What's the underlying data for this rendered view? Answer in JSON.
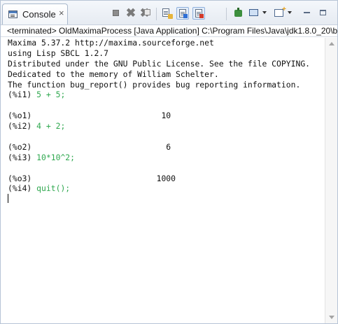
{
  "view": {
    "tab_label": "Console",
    "tab_close_glyph": "×",
    "tab_icon": "console-icon"
  },
  "toolbar": {
    "buttons": [
      {
        "name": "terminate",
        "icon": "terminate-icon"
      },
      {
        "name": "remove-launch",
        "icon": "remove-icon",
        "glyph": "✖"
      },
      {
        "name": "remove-all-terminated",
        "icon": "remove-all-icon",
        "glyph": "✖"
      },
      {
        "name": "scroll-lock",
        "icon": "scroll-lock-icon"
      },
      {
        "name": "show-console-on-stdout",
        "icon": "stdout-icon"
      },
      {
        "name": "show-console-on-stderr",
        "icon": "stderr-icon"
      },
      {
        "name": "pin-console",
        "icon": "pin-icon"
      },
      {
        "name": "display-selected-console",
        "icon": "display-console-icon"
      },
      {
        "name": "open-console",
        "icon": "open-console-icon"
      },
      {
        "name": "minimize",
        "icon": "minimize-icon"
      },
      {
        "name": "maximize",
        "icon": "maximize-icon"
      }
    ]
  },
  "process": {
    "label": "<terminated> OldMaximaProcess [Java Application] C:\\Program Files\\Java\\jdk1.8.0_20\\b"
  },
  "console": {
    "lines": [
      {
        "out": "Maxima 5.37.2 http://maxima.sourceforge.net",
        "in": ""
      },
      {
        "out": "using Lisp SBCL 1.2.7",
        "in": ""
      },
      {
        "out": "Distributed under the GNU Public License. See the file COPYING.",
        "in": ""
      },
      {
        "out": "Dedicated to the memory of William Schelter.",
        "in": ""
      },
      {
        "out": "The function bug_report() provides bug reporting information.",
        "in": ""
      },
      {
        "out": "(%i1) ",
        "in": "5 + 5;"
      },
      {
        "out": "",
        "in": ""
      },
      {
        "out": "(%o1)                           10",
        "in": ""
      },
      {
        "out": "(%i2) ",
        "in": "4 + 2;"
      },
      {
        "out": "",
        "in": ""
      },
      {
        "out": "(%o2)                            6",
        "in": ""
      },
      {
        "out": "(%i3) ",
        "in": "10*10^2;"
      },
      {
        "out": "",
        "in": ""
      },
      {
        "out": "(%o3)                          1000",
        "in": ""
      },
      {
        "out": "(%i4) ",
        "in": "quit();"
      }
    ]
  },
  "colors": {
    "input_text": "#2fa84f",
    "output_text": "#111111"
  }
}
